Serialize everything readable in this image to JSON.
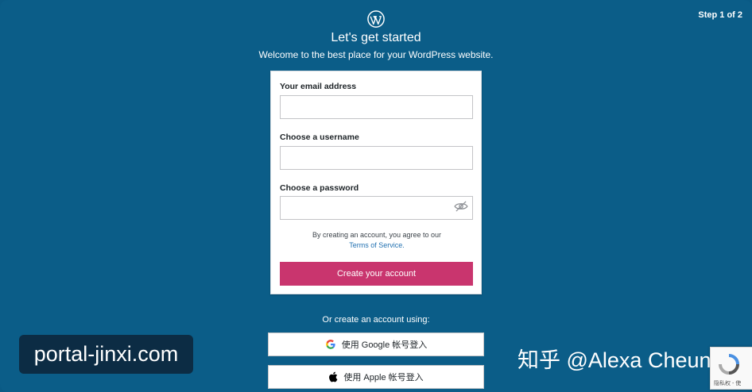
{
  "header": {
    "step": "Step 1 of 2",
    "title": "Let's get started",
    "subtitle": "Welcome to the best place for your WordPress website."
  },
  "form": {
    "email_label": "Your email address",
    "email_value": "",
    "username_label": "Choose a username",
    "username_value": "",
    "password_label": "Choose a password",
    "password_value": "",
    "tos_text": "By creating an account, you agree to our",
    "tos_link": "Terms of Service.",
    "create_button": "Create your account"
  },
  "social": {
    "or_text": "Or create an account using:",
    "google_label": "使用 Google 帐号登入",
    "apple_label": "使用 Apple 帐号登入"
  },
  "watermarks": {
    "left": "portal-jinxi.com",
    "right": "知乎 @Alexa Cheung"
  },
  "recaptcha": {
    "text": "隐私权 - 使"
  },
  "colors": {
    "background": "#0b5d88",
    "primary_button": "#c9356e",
    "link": "#2271b1"
  }
}
